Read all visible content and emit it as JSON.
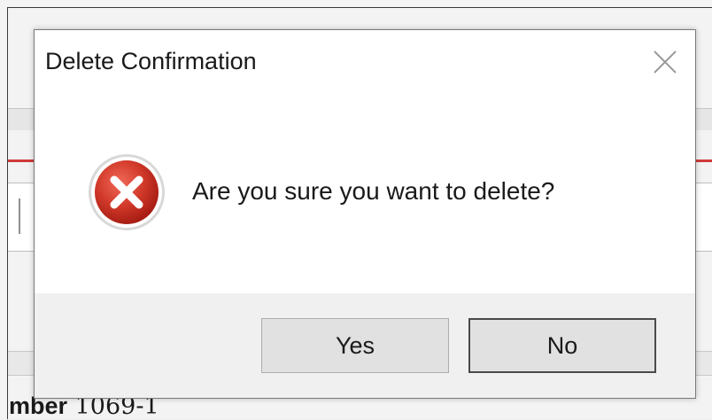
{
  "background": {
    "label_bold": "mber",
    "label_rest": " 1069-1"
  },
  "dialog": {
    "title": "Delete Confirmation",
    "close_icon": "close-icon",
    "message_icon": "error-icon",
    "message": "Are you sure you want to delete?",
    "buttons": {
      "yes": "Yes",
      "no": "No"
    }
  },
  "colors": {
    "error_red": "#c42b1c",
    "accent_line": "#cf3a3a",
    "dialog_bg": "#ffffff",
    "button_bar_bg": "#f0f0f0"
  }
}
